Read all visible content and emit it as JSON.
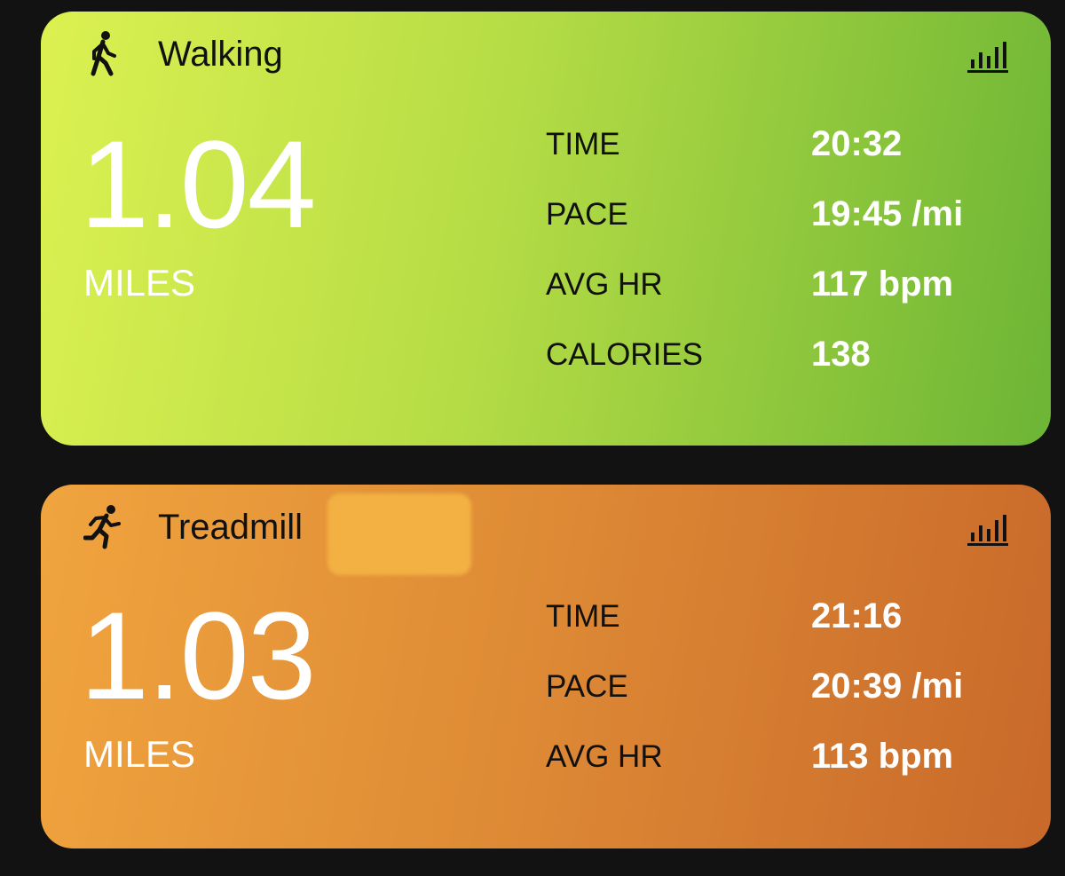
{
  "cards": [
    {
      "title": "Walking",
      "icon": "walking-icon",
      "distance_value": "1.04",
      "distance_unit": "MILES",
      "stats": [
        {
          "label": "TIME",
          "value": "20:32"
        },
        {
          "label": "PACE",
          "value": "19:45 /mi"
        },
        {
          "label": "AVG HR",
          "value": "117 bpm"
        },
        {
          "label": "CALORIES",
          "value": "138"
        }
      ],
      "colors": {
        "gradient_start": "#dcf151",
        "gradient_end": "#6db535"
      }
    },
    {
      "title": "Treadmill",
      "icon": "running-icon",
      "distance_value": "1.03",
      "distance_unit": "MILES",
      "stats": [
        {
          "label": "TIME",
          "value": "21:16"
        },
        {
          "label": "PACE",
          "value": "20:39 /mi"
        },
        {
          "label": "AVG HR",
          "value": "113 bpm"
        }
      ],
      "colors": {
        "gradient_start": "#f0a43e",
        "gradient_end": "#c8692a"
      }
    }
  ],
  "chart_button_icon": "bar-chart-icon",
  "background": "#121212"
}
